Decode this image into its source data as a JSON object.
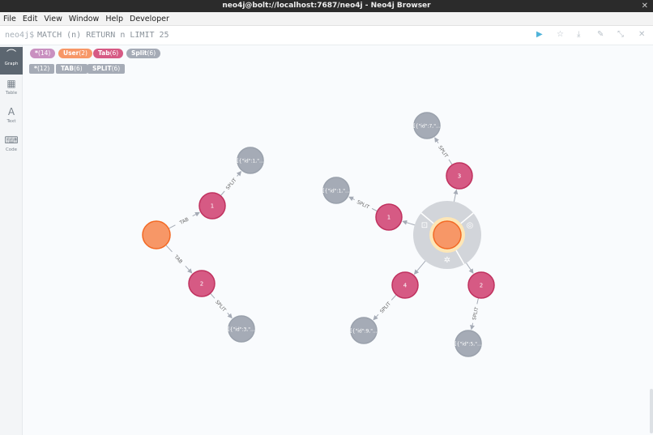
{
  "window": {
    "title": "neo4j@bolt://localhost:7687/neo4j - Neo4j Browser",
    "close_glyph": "✕"
  },
  "menu": [
    "File",
    "Edit",
    "View",
    "Window",
    "Help",
    "Developer"
  ],
  "editor": {
    "prompt": "neo4j$",
    "query": "MATCH (n) RETURN n LIMIT 25"
  },
  "toolbar_icons": [
    "run-icon",
    "star-icon",
    "download-icon",
    "pin-icon",
    "collapse-icon",
    "close-icon"
  ],
  "sidebar": [
    {
      "label": "Graph",
      "icon": "graph-icon",
      "active": true
    },
    {
      "label": "Table",
      "icon": "table-icon",
      "active": false
    },
    {
      "label": "Text",
      "icon": "text-icon",
      "active": false
    },
    {
      "label": "Code",
      "icon": "code-icon",
      "active": false
    }
  ],
  "node_labels": [
    {
      "name": "*",
      "count": "(14)",
      "color": "#c990c0"
    },
    {
      "name": "User",
      "count": "(2)",
      "color": "#f79767"
    },
    {
      "name": "Tab",
      "count": "(6)",
      "color": "#d65a84"
    },
    {
      "name": "Split",
      "count": "(6)",
      "color": "#a5abb6"
    }
  ],
  "rel_types": [
    {
      "name": "*",
      "count": "(12)"
    },
    {
      "name": "TAB",
      "count": "(6)"
    },
    {
      "name": "SPLIT",
      "count": "(6)"
    }
  ],
  "graph": {
    "colors": {
      "user": "#f79767",
      "user_stroke": "#f36924",
      "tab": "#d65a84",
      "tab_stroke": "#c0325f",
      "split": "#a5abb6",
      "split_stroke": "#9aa1ac",
      "edge": "#a5abb6",
      "ring": "#d2d5da",
      "ring_glow": "#fde6b6"
    },
    "nodes": [
      {
        "id": "u1",
        "type": "user",
        "caption": ""
      },
      {
        "id": "t1",
        "type": "tab",
        "caption": "1"
      },
      {
        "id": "t2",
        "type": "tab",
        "caption": "2"
      },
      {
        "id": "s1",
        "type": "split",
        "caption": "[{\"id\":1,\"..."
      },
      {
        "id": "s2",
        "type": "split",
        "caption": "[{\"id\":3,\"..."
      },
      {
        "id": "u2",
        "type": "user",
        "caption": "",
        "selected": true
      },
      {
        "id": "t3",
        "type": "tab",
        "caption": "3"
      },
      {
        "id": "t4",
        "type": "tab",
        "caption": "1"
      },
      {
        "id": "t5",
        "type": "tab",
        "caption": "4"
      },
      {
        "id": "t6",
        "type": "tab",
        "caption": "2"
      },
      {
        "id": "s3",
        "type": "split",
        "caption": "[{\"id\":7,\"..."
      },
      {
        "id": "s4",
        "type": "split",
        "caption": "[{\"id\":1,\"..."
      },
      {
        "id": "s5",
        "type": "split",
        "caption": "[{\"id\":9,\"..."
      },
      {
        "id": "s6",
        "type": "split",
        "caption": "[{\"id\":5,\"..."
      }
    ],
    "edges": [
      {
        "from": "u1",
        "to": "t1",
        "label": "TAB"
      },
      {
        "from": "u1",
        "to": "t2",
        "label": "TAB"
      },
      {
        "from": "t1",
        "to": "s1",
        "label": "SPLIT"
      },
      {
        "from": "t2",
        "to": "s2",
        "label": "SPLIT"
      },
      {
        "from": "u2",
        "to": "t3",
        "label": ""
      },
      {
        "from": "u2",
        "to": "t4",
        "label": ""
      },
      {
        "from": "u2",
        "to": "t5",
        "label": ""
      },
      {
        "from": "u2",
        "to": "t6",
        "label": ""
      },
      {
        "from": "t3",
        "to": "s3",
        "label": "SPLIT"
      },
      {
        "from": "t4",
        "to": "s4",
        "label": "SPLIT"
      },
      {
        "from": "t5",
        "to": "s5",
        "label": "SPLIT"
      },
      {
        "from": "t6",
        "to": "s6",
        "label": "SPLIT"
      }
    ]
  }
}
